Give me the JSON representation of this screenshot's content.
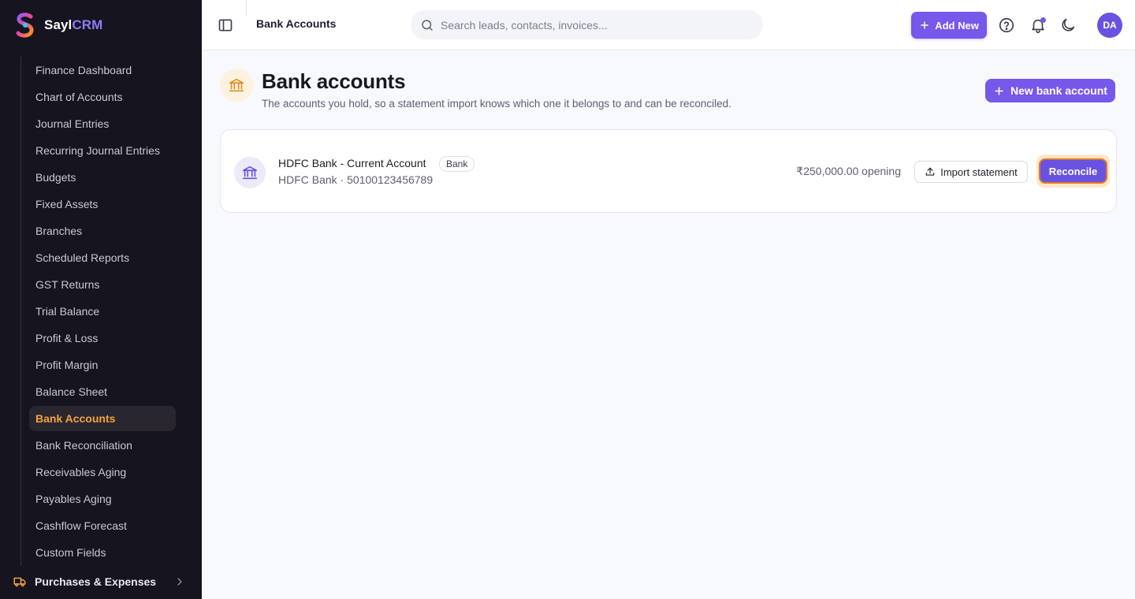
{
  "brand": {
    "name_prefix": "Sayl",
    "name_suffix": "CRM"
  },
  "sidebar": {
    "items": [
      {
        "label": "Finance Dashboard",
        "active": false
      },
      {
        "label": "Chart of Accounts",
        "active": false
      },
      {
        "label": "Journal Entries",
        "active": false
      },
      {
        "label": "Recurring Journal Entries",
        "active": false
      },
      {
        "label": "Budgets",
        "active": false
      },
      {
        "label": "Fixed Assets",
        "active": false
      },
      {
        "label": "Branches",
        "active": false
      },
      {
        "label": "Scheduled Reports",
        "active": false
      },
      {
        "label": "GST Returns",
        "active": false
      },
      {
        "label": "Trial Balance",
        "active": false
      },
      {
        "label": "Profit & Loss",
        "active": false
      },
      {
        "label": "Profit Margin",
        "active": false
      },
      {
        "label": "Balance Sheet",
        "active": false
      },
      {
        "label": "Bank Accounts",
        "active": true
      },
      {
        "label": "Bank Reconciliation",
        "active": false
      },
      {
        "label": "Receivables Aging",
        "active": false
      },
      {
        "label": "Payables Aging",
        "active": false
      },
      {
        "label": "Cashflow Forecast",
        "active": false
      },
      {
        "label": "Custom Fields",
        "active": false
      }
    ],
    "group": {
      "label": "Purchases & Expenses",
      "icon": "truck-icon"
    }
  },
  "topbar": {
    "title": "Bank Accounts",
    "search_placeholder": "Search leads, contacts, invoices...",
    "add_new_label": "Add New",
    "avatar_initials": "DA"
  },
  "page": {
    "title": "Bank accounts",
    "subtitle": "The accounts you hold, so a statement import knows which one it belongs to and can be reconciled.",
    "new_account_label": "New bank account"
  },
  "accounts": [
    {
      "name": "HDFC Bank - Current Account",
      "type_badge": "Bank",
      "details": "HDFC Bank · 50100123456789",
      "opening": "₹250,000.00 opening",
      "import_label": "Import statement",
      "reconcile_label": "Reconcile"
    }
  ],
  "colors": {
    "accent": "#7658ea",
    "sidebar_bg": "#15141f",
    "active_nav": "#f2a33a",
    "focus_ring": "#e07a1f"
  }
}
